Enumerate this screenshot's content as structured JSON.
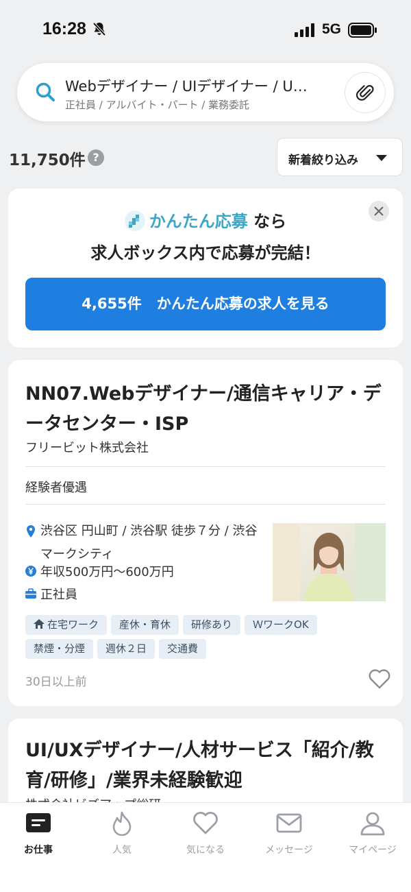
{
  "status_bar": {
    "time": "16:28",
    "network": "5G"
  },
  "search": {
    "title": "Webデザイナー / UIデザイナー / U…",
    "subtitle": "正社員 / アルバイト・パート / 業務委託"
  },
  "results": {
    "count": "11,750件",
    "help": "?"
  },
  "filter": {
    "label": "新着絞り込み"
  },
  "promo": {
    "brand": "かんたん応募",
    "brand_suffix": "なら",
    "line2": "求人ボックス内で応募が完結！",
    "cta_count": "4,655件",
    "cta_text": "かんたん応募の求人を見る"
  },
  "job_card": {
    "title": "NN07.Webデザイナー/通信キャリア・データセンター・ISP",
    "company": "フリービット株式会社",
    "feature": "経験者優遇",
    "location": "渋谷区 円山町 / 渋谷駅 徒歩７分 / 渋谷マークシティ",
    "salary": "年収500万円〜600万円",
    "employment": "正社員",
    "tags": [
      "在宅ワーク",
      "産休・育休",
      "研修あり",
      "ＷワークOK",
      "禁煙・分煙",
      "週休２日",
      "交通費"
    ],
    "posted": "30日以上前"
  },
  "job_card_2": {
    "title": "UI/UXデザイナー/人材サービス「紹介/教育/研修」/業界未経験歓迎",
    "company": "株式会社ビズアップ総研"
  },
  "bottom_nav": [
    {
      "label": "お仕事",
      "icon": "jobs-icon",
      "active": true
    },
    {
      "label": "人気",
      "icon": "fire-icon",
      "active": false
    },
    {
      "label": "気になる",
      "icon": "heart-icon",
      "active": false
    },
    {
      "label": "メッセージ",
      "icon": "mail-icon",
      "active": false
    },
    {
      "label": "マイページ",
      "icon": "person-icon",
      "active": false
    }
  ],
  "colors": {
    "accent": "#1f7fe0",
    "brand": "#3aa7c7",
    "tag_bg": "#e8eef5",
    "page_bg": "#eef0f2"
  }
}
